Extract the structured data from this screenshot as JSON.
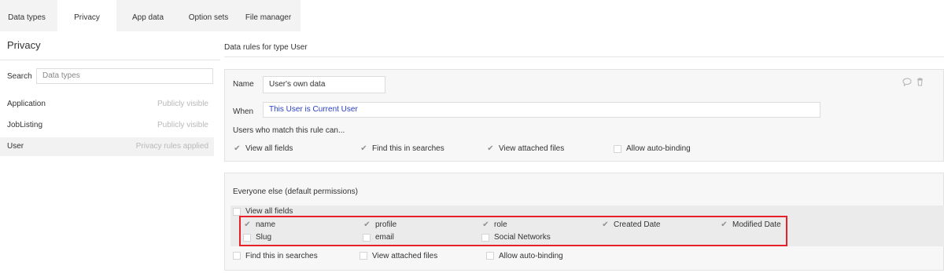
{
  "tabs": [
    "Data types",
    "Privacy",
    "App data",
    "Option sets",
    "File manager"
  ],
  "left": {
    "title": "Privacy",
    "search_label": "Search",
    "search_placeholder": "Data types",
    "items": [
      {
        "name": "Application",
        "status": "Publicly visible"
      },
      {
        "name": "JobListing",
        "status": "Publicly visible"
      },
      {
        "name": "User",
        "status": "Privacy rules applied"
      }
    ]
  },
  "main": {
    "heading": "Data rules for type User",
    "rule": {
      "name_label": "Name",
      "name_value": "User's own data",
      "when_label": "When",
      "when_value": "This User is Current User",
      "can_label": "Users who match this rule can...",
      "options": [
        {
          "label": "View all fields",
          "checked": true
        },
        {
          "label": "Find this in searches",
          "checked": true
        },
        {
          "label": "View attached files",
          "checked": true
        },
        {
          "label": "Allow auto-binding",
          "checked": false
        }
      ]
    },
    "default": {
      "title": "Everyone else (default permissions)",
      "view_all": {
        "label": "View all fields",
        "checked": false
      },
      "fields": [
        {
          "label": "name",
          "checked": true
        },
        {
          "label": "profile",
          "checked": true
        },
        {
          "label": "role",
          "checked": true
        },
        {
          "label": "Created Date",
          "checked": true
        },
        {
          "label": "Modified Date",
          "checked": true
        },
        {
          "label": "Slug",
          "checked": false
        },
        {
          "label": "email",
          "checked": false
        },
        {
          "label": "Social Networks",
          "checked": false
        }
      ],
      "options": [
        {
          "label": "Find this in searches",
          "checked": false
        },
        {
          "label": "View attached files",
          "checked": false
        },
        {
          "label": "Allow auto-binding",
          "checked": false
        }
      ]
    }
  },
  "icons": {
    "comment": "comment-icon",
    "trash": "trash-icon"
  },
  "colors": {
    "highlight": "#e8202a",
    "link": "#2a3ec4"
  }
}
